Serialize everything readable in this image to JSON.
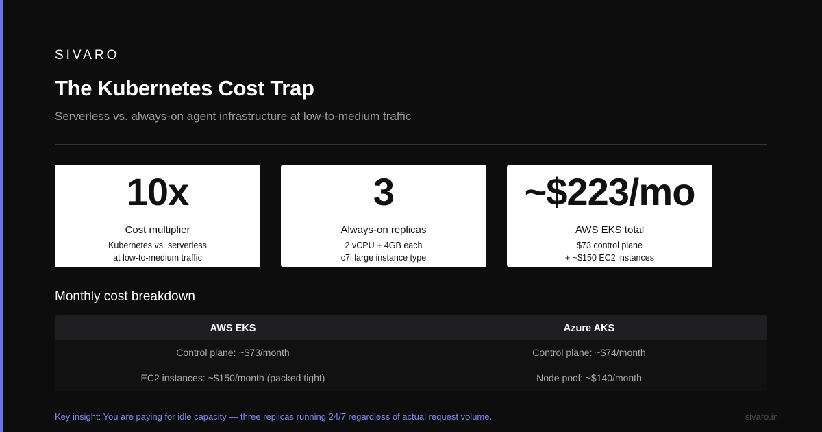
{
  "colors": {
    "background": "#0d0d0d",
    "accent": "#6a73e6",
    "card_background": "#ffffff",
    "insight_text": "#8088f0"
  },
  "header": {
    "brand": "SIVARO",
    "title": "The Kubernetes Cost Trap",
    "subtitle": "Serverless vs. always-on agent infrastructure at low-to-medium traffic"
  },
  "stats": [
    {
      "value": "10x",
      "label": "Cost multiplier",
      "details": [
        "Kubernetes vs. serverless",
        "at low-to-medium traffic"
      ]
    },
    {
      "value": "3",
      "label": "Always-on replicas",
      "details": [
        "2 vCPU + 4GB each",
        "c7i.large instance type"
      ]
    },
    {
      "value": "~$223/mo",
      "label": "AWS EKS total",
      "details": [
        "$73 control plane",
        "+ ~$150 EC2 instances"
      ]
    }
  ],
  "breakdown": {
    "title": "Monthly cost breakdown",
    "columns": [
      {
        "header": "AWS EKS",
        "rows": [
          "Control plane: ~$73/month",
          "EC2 instances: ~$150/month (packed tight)"
        ]
      },
      {
        "header": "Azure AKS",
        "rows": [
          "Control plane: ~$74/month",
          "Node pool: ~$140/month"
        ]
      }
    ]
  },
  "footer": {
    "insight": "Key insight: You are paying for idle capacity — three replicas running 24/7 regardless of actual request volume.",
    "site": "sivaro.in"
  }
}
